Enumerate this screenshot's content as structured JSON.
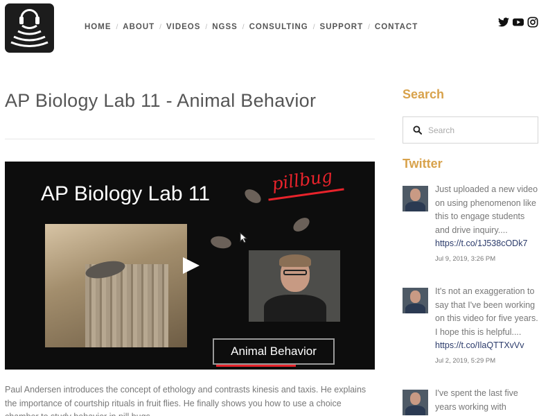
{
  "nav": {
    "items": [
      "HOME",
      "ABOUT",
      "VIDEOS",
      "NGSS",
      "CONSULTING",
      "SUPPORT",
      "CONTACT"
    ]
  },
  "social": [
    "twitter-icon",
    "youtube-icon",
    "instagram-icon"
  ],
  "page": {
    "title": "AP Biology Lab 11 - Animal Behavior"
  },
  "video": {
    "title_text": "AP Biology Lab 11",
    "handwriting": "pillbug",
    "label": "Animal Behavior"
  },
  "description": "Paul Andersen introduces the concept of ethology and contrasts kinesis and taxis. He explains the importance of courtship rituals in fruit flies. He finally shows you how to use a choice chamber to study behavior in pill bugs.",
  "sidebar": {
    "search_heading": "Search",
    "search_placeholder": "Search",
    "twitter_heading": "Twitter",
    "tweets": [
      {
        "text": "Just uploaded a new video on using phenomenon like this to engage students and drive inquiry....",
        "link": "https://t.co/1J538cODk7",
        "date": "Jul 9, 2019, 3:26 PM"
      },
      {
        "text": "It's not an exaggeration to say that I've been working on this video for five years. I hope this is helpful....",
        "link": "https://t.co/IlaQTTXvVv",
        "date": "Jul 2, 2019, 5:29 PM"
      },
      {
        "text": "I've spent the last five years working with",
        "link": "",
        "date": ""
      }
    ]
  },
  "colors": {
    "accent": "#d8a24b",
    "link": "#2a3a6a",
    "logo_bg": "#1c1c1c"
  }
}
